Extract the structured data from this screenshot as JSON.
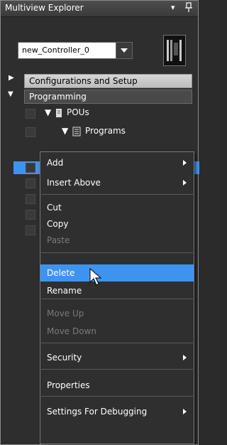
{
  "panel": {
    "title": "Multiview Explorer",
    "pin_glyph": "▾"
  },
  "controller": {
    "selected": "new_Controller_0"
  },
  "tree": {
    "config_label": "Configurations and Setup",
    "programming_label": "Programming",
    "pous_label": "POUs",
    "programs_label": "Programs"
  },
  "context_menu": {
    "add": "Add",
    "insert_above": "Insert Above",
    "cut": "Cut",
    "copy": "Copy",
    "paste": "Paste",
    "delete": "Delete",
    "rename": "Rename",
    "move_up": "Move Up",
    "move_down": "Move Down",
    "security": "Security",
    "properties": "Properties",
    "settings_debugging": "Settings For Debugging"
  },
  "colors": {
    "highlight": "#3f93ef",
    "disabled_text": "#7a7a7a"
  }
}
